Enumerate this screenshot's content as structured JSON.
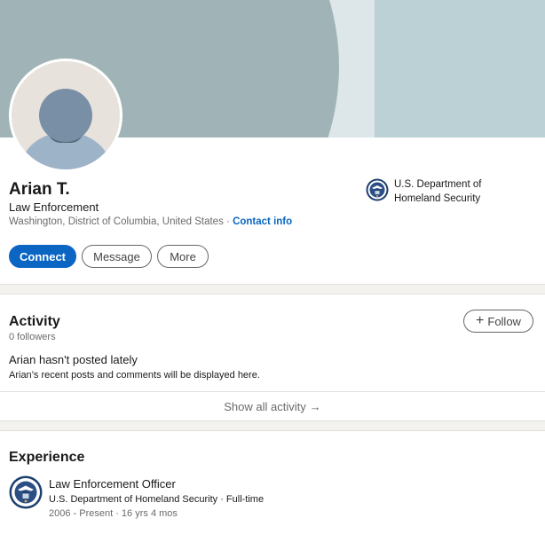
{
  "profile": {
    "name": "Arian T.",
    "headline": "Law Enforcement",
    "location": "Washington, District of Columbia, United States",
    "separator": " · ",
    "contact_info": "Contact info",
    "current_org": "U.S. Department of Homeland Security",
    "avatar_icon": "default-person-avatar"
  },
  "actions": {
    "connect": "Connect",
    "message": "Message",
    "more": "More"
  },
  "activity": {
    "title": "Activity",
    "followers": "0 followers",
    "follow_label": "Follow",
    "follow_icon": "plus-icon",
    "empty_title": "Arian hasn't posted lately",
    "empty_subtitle": "Arian’s recent posts and comments will be displayed here.",
    "show_all": "Show all activity",
    "show_all_icon": "arrow-right-icon"
  },
  "experience": {
    "title": "Experience",
    "items": [
      {
        "role": "Law Enforcement Officer",
        "company": "U.S. Department of Homeland Security · Full-time",
        "dates": "2006 - Present · 16 yrs 4 mos",
        "logo_icon": "dhs-seal-icon"
      }
    ]
  },
  "colors": {
    "brand_blue": "#0a66c2",
    "banner_dark": "#a0b4b7",
    "banner_light": "#dde6e8",
    "banner_right": "#bcd1d5"
  }
}
